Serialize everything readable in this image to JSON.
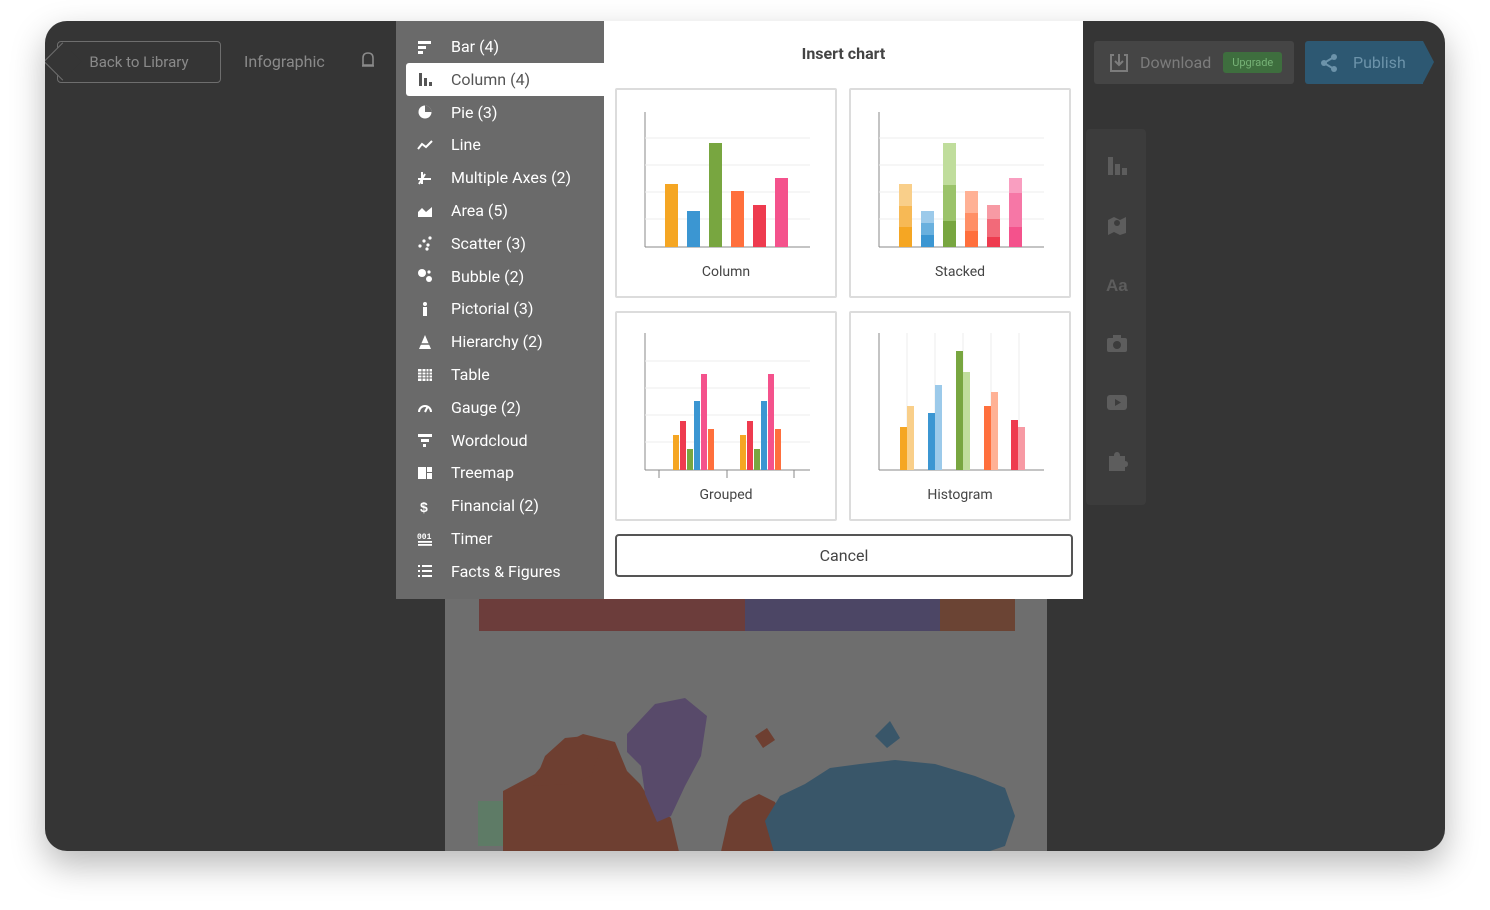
{
  "topbar": {
    "back_label": "Back to Library",
    "project_title": "Infographic",
    "download_label": "Download",
    "upgrade_label": "Upgrade",
    "publish_label": "Publish"
  },
  "menu": {
    "items": [
      {
        "label": "Bar (4)",
        "icon": "bar-chart-icon",
        "active": false
      },
      {
        "label": "Column (4)",
        "icon": "column-chart-icon",
        "active": true
      },
      {
        "label": "Pie (3)",
        "icon": "pie-chart-icon",
        "active": false
      },
      {
        "label": "Line",
        "icon": "line-chart-icon",
        "active": false
      },
      {
        "label": "Multiple Axes (2)",
        "icon": "multiple-axes-icon",
        "active": false
      },
      {
        "label": "Area (5)",
        "icon": "area-chart-icon",
        "active": false
      },
      {
        "label": "Scatter (3)",
        "icon": "scatter-chart-icon",
        "active": false
      },
      {
        "label": "Bubble (2)",
        "icon": "bubble-chart-icon",
        "active": false
      },
      {
        "label": "Pictorial (3)",
        "icon": "pictorial-icon",
        "active": false
      },
      {
        "label": "Hierarchy (2)",
        "icon": "hierarchy-icon",
        "active": false
      },
      {
        "label": "Table",
        "icon": "table-icon",
        "active": false
      },
      {
        "label": "Gauge (2)",
        "icon": "gauge-icon",
        "active": false
      },
      {
        "label": "Wordcloud",
        "icon": "wordcloud-icon",
        "active": false
      },
      {
        "label": "Treemap",
        "icon": "treemap-icon",
        "active": false
      },
      {
        "label": "Financial (2)",
        "icon": "financial-icon",
        "active": false
      },
      {
        "label": "Timer",
        "icon": "timer-icon",
        "active": false
      },
      {
        "label": "Facts & Figures",
        "icon": "facts-figures-icon",
        "active": false
      }
    ]
  },
  "dialog": {
    "title": "Insert chart",
    "options": [
      {
        "label": "Column"
      },
      {
        "label": "Stacked"
      },
      {
        "label": "Grouped"
      },
      {
        "label": "Histogram"
      }
    ],
    "cancel_label": "Cancel"
  },
  "toolbar_icons": [
    "charts-icon",
    "map-icon",
    "text-icon",
    "camera-icon",
    "video-icon",
    "puzzle-icon"
  ],
  "colors": {
    "orange": "#f5a623",
    "blue": "#3b96d2",
    "green": "#78a640",
    "coral": "#ff6f3c",
    "red": "#ee3b4f",
    "pink": "#f4528c"
  }
}
